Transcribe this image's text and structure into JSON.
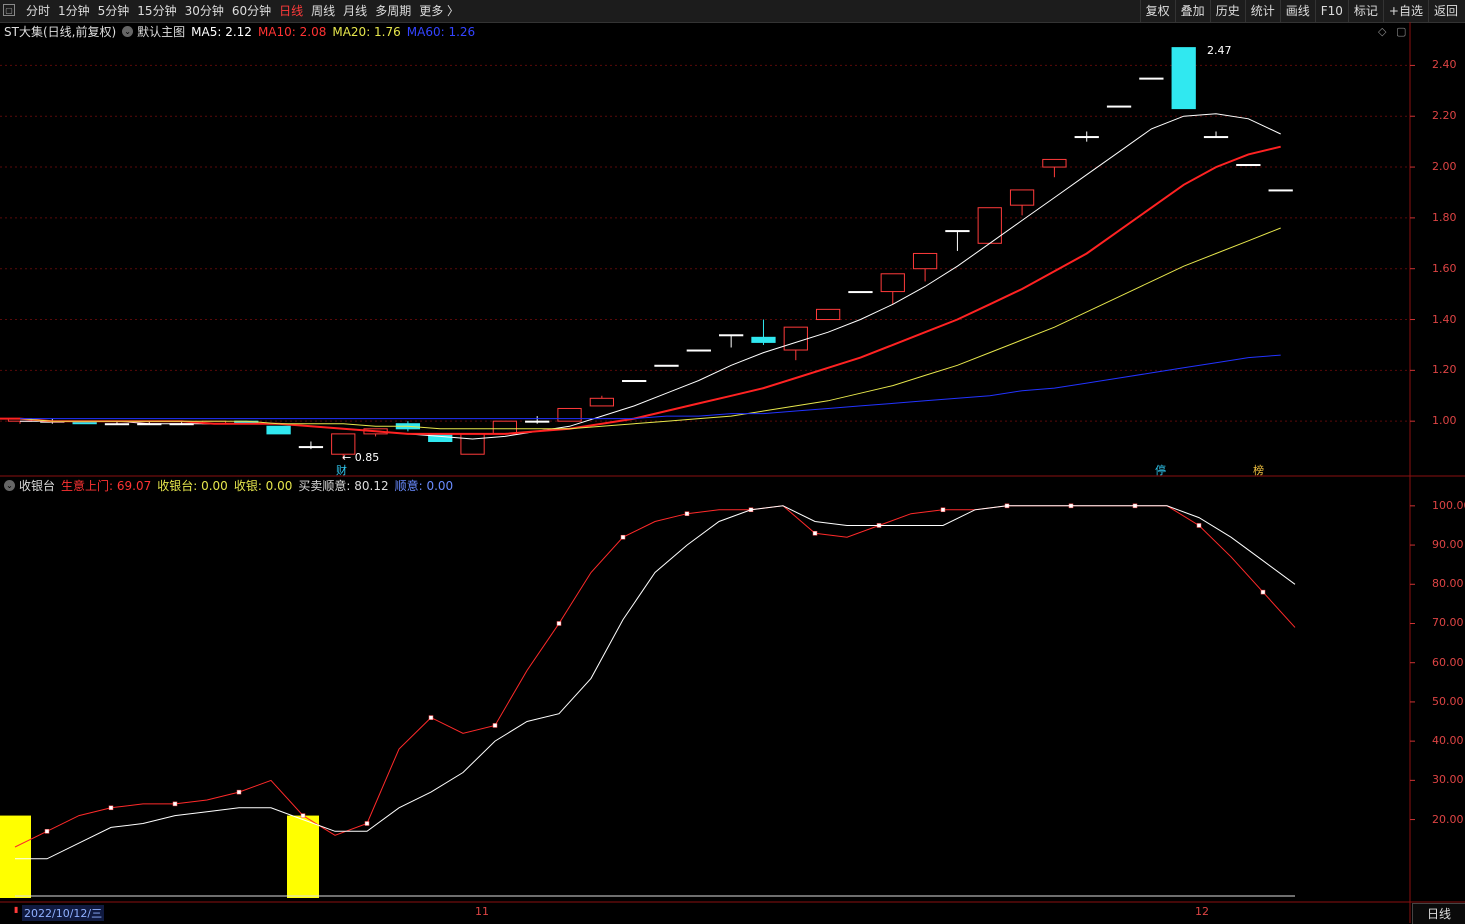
{
  "toolbar": {
    "periods": [
      "分时",
      "1分钟",
      "5分钟",
      "15分钟",
      "30分钟",
      "60分钟",
      "日线",
      "周线",
      "月线",
      "多周期",
      "更多 〉"
    ],
    "active_period": "日线",
    "tools": [
      "复权",
      "叠加",
      "历史",
      "统计",
      "画线",
      "F10",
      "标记",
      "+自选",
      "返回"
    ]
  },
  "main_legend": {
    "stock": "ST大集(日线,前复权)",
    "indicator": "默认主图",
    "ma5": "MA5: 2.12",
    "ma10": "MA10: 2.08",
    "ma20": "MA20: 1.76",
    "ma60": "MA60: 1.26"
  },
  "sub_legend": {
    "name": "收银台",
    "v1": "生意上门: 69.07",
    "v2": "收银台: 0.00",
    "v3": "收银: 0.00",
    "v4": "买卖顺意: 80.12",
    "v5": "顺意: 0.00"
  },
  "annotations": {
    "high": "2.47",
    "low": "0.85",
    "cai": "财",
    "ting": "停",
    "bang": "榜"
  },
  "x_axis": {
    "date": "2022/10/12/三",
    "m11": "11",
    "m12": "12"
  },
  "bottom_tab": "日线",
  "colors": {
    "up": "#ff3b3b",
    "down": "#30e8f0",
    "ma5": "#ffffff",
    "ma10": "#ff2222",
    "ma20": "#e6e64c",
    "ma60": "#2233ff",
    "sub_red": "#ff2a2a",
    "sub_white": "#ffffff",
    "bar": "#ffff00"
  },
  "chart_data": [
    {
      "type": "candlestick",
      "y_ticks": [
        1.0,
        1.2,
        1.4,
        1.6,
        1.8,
        2.0,
        2.2,
        2.4
      ],
      "ylim": [
        0.8,
        2.5
      ],
      "candles": [
        {
          "o": 1.0,
          "c": 1.01,
          "h": 1.01,
          "l": 0.99
        },
        {
          "o": 1.0,
          "c": 1.0,
          "h": 1.01,
          "l": 0.99
        },
        {
          "o": 1.0,
          "c": 0.99,
          "h": 1.0,
          "l": 0.99
        },
        {
          "o": 0.99,
          "c": 0.99,
          "h": 1.0,
          "l": 0.99
        },
        {
          "o": 0.99,
          "c": 0.99,
          "h": 1.0,
          "l": 0.99
        },
        {
          "o": 0.99,
          "c": 0.99,
          "h": 1.0,
          "l": 0.99
        },
        {
          "o": 0.99,
          "c": 1.0,
          "h": 1.0,
          "l": 0.99
        },
        {
          "o": 1.0,
          "c": 0.99,
          "h": 1.0,
          "l": 0.99
        },
        {
          "o": 0.98,
          "c": 0.95,
          "h": 0.98,
          "l": 0.95
        },
        {
          "o": 0.9,
          "c": 0.9,
          "h": 0.92,
          "l": 0.89
        },
        {
          "o": 0.87,
          "c": 0.95,
          "h": 0.95,
          "l": 0.85
        },
        {
          "o": 0.95,
          "c": 0.97,
          "h": 0.97,
          "l": 0.94
        },
        {
          "o": 0.99,
          "c": 0.97,
          "h": 1.0,
          "l": 0.96
        },
        {
          "o": 0.95,
          "c": 0.92,
          "h": 0.95,
          "l": 0.92
        },
        {
          "o": 0.87,
          "c": 0.95,
          "h": 0.95,
          "l": 0.87
        },
        {
          "o": 0.95,
          "c": 1.0,
          "h": 1.0,
          "l": 0.95
        },
        {
          "o": 1.0,
          "c": 1.0,
          "h": 1.02,
          "l": 0.99
        },
        {
          "o": 1.0,
          "c": 1.05,
          "h": 1.05,
          "l": 1.0
        },
        {
          "o": 1.06,
          "c": 1.09,
          "h": 1.1,
          "l": 1.06
        },
        {
          "o": 1.16,
          "c": 1.16,
          "h": 1.16,
          "l": 1.16
        },
        {
          "o": 1.22,
          "c": 1.22,
          "h": 1.22,
          "l": 1.22
        },
        {
          "o": 1.28,
          "c": 1.28,
          "h": 1.28,
          "l": 1.28
        },
        {
          "o": 1.34,
          "c": 1.34,
          "h": 1.34,
          "l": 1.29
        },
        {
          "o": 1.33,
          "c": 1.31,
          "h": 1.4,
          "l": 1.3
        },
        {
          "o": 1.28,
          "c": 1.37,
          "h": 1.37,
          "l": 1.24
        },
        {
          "o": 1.4,
          "c": 1.44,
          "h": 1.44,
          "l": 1.4
        },
        {
          "o": 1.51,
          "c": 1.51,
          "h": 1.51,
          "l": 1.51
        },
        {
          "o": 1.51,
          "c": 1.58,
          "h": 1.58,
          "l": 1.46
        },
        {
          "o": 1.6,
          "c": 1.66,
          "h": 1.66,
          "l": 1.55
        },
        {
          "o": 1.75,
          "c": 1.75,
          "h": 1.75,
          "l": 1.67
        },
        {
          "o": 1.7,
          "c": 1.84,
          "h": 1.84,
          "l": 1.7
        },
        {
          "o": 1.85,
          "c": 1.91,
          "h": 1.91,
          "l": 1.81
        },
        {
          "o": 2.0,
          "c": 2.03,
          "h": 2.03,
          "l": 1.96
        },
        {
          "o": 2.12,
          "c": 2.12,
          "h": 2.14,
          "l": 2.1
        },
        {
          "o": 2.24,
          "c": 2.24,
          "h": 2.24,
          "l": 2.24
        },
        {
          "o": 2.35,
          "c": 2.35,
          "h": 2.35,
          "l": 2.35
        },
        {
          "o": 2.47,
          "c": 2.23,
          "h": 2.47,
          "l": 2.23
        },
        {
          "o": 2.12,
          "c": 2.12,
          "h": 2.14,
          "l": 2.12
        },
        {
          "o": 2.01,
          "c": 2.01,
          "h": 2.01,
          "l": 2.01
        },
        {
          "o": 1.91,
          "c": 1.91,
          "h": 1.91,
          "l": 1.91
        }
      ],
      "series": [
        {
          "name": "MA5",
          "color": "#ffffff",
          "values": [
            1.0,
            1.0,
            1.0,
            1.0,
            0.99,
            0.99,
            0.99,
            0.99,
            0.99,
            0.98,
            0.97,
            0.96,
            0.95,
            0.94,
            0.93,
            0.94,
            0.96,
            0.98,
            1.02,
            1.06,
            1.11,
            1.16,
            1.22,
            1.27,
            1.31,
            1.35,
            1.4,
            1.46,
            1.53,
            1.61,
            1.7,
            1.79,
            1.88,
            1.97,
            2.06,
            2.15,
            2.2,
            2.21,
            2.19,
            2.13
          ]
        },
        {
          "name": "MA10",
          "color": "#ff2222",
          "values": [
            1.01,
            1.01,
            1.0,
            1.0,
            1.0,
            1.0,
            1.0,
            0.99,
            0.99,
            0.99,
            0.98,
            0.97,
            0.96,
            0.95,
            0.95,
            0.95,
            0.95,
            0.96,
            0.97,
            0.99,
            1.01,
            1.04,
            1.07,
            1.1,
            1.13,
            1.17,
            1.21,
            1.25,
            1.3,
            1.35,
            1.4,
            1.46,
            1.52,
            1.59,
            1.66,
            1.75,
            1.84,
            1.93,
            2.0,
            2.05,
            2.08
          ]
        },
        {
          "name": "MA20",
          "color": "#e6e64c",
          "values": [
            1.01,
            1.0,
            1.0,
            1.0,
            1.0,
            1.0,
            1.0,
            1.0,
            0.99,
            0.99,
            0.99,
            0.98,
            0.98,
            0.97,
            0.97,
            0.97,
            0.97,
            0.97,
            0.98,
            0.99,
            1.0,
            1.01,
            1.02,
            1.04,
            1.06,
            1.08,
            1.11,
            1.14,
            1.18,
            1.22,
            1.27,
            1.32,
            1.37,
            1.43,
            1.49,
            1.55,
            1.61,
            1.66,
            1.71,
            1.76
          ]
        },
        {
          "name": "MA60",
          "color": "#2233ff",
          "values": [
            1.01,
            1.01,
            1.01,
            1.01,
            1.01,
            1.01,
            1.01,
            1.01,
            1.01,
            1.01,
            1.01,
            1.01,
            1.01,
            1.01,
            1.01,
            1.01,
            1.01,
            1.01,
            1.01,
            1.01,
            1.02,
            1.02,
            1.03,
            1.03,
            1.04,
            1.05,
            1.06,
            1.07,
            1.08,
            1.09,
            1.1,
            1.12,
            1.13,
            1.15,
            1.17,
            1.19,
            1.21,
            1.23,
            1.25,
            1.26
          ]
        }
      ]
    },
    {
      "type": "line",
      "y_ticks": [
        20,
        30,
        40,
        50,
        60,
        70,
        80,
        90,
        100
      ],
      "ylim": [
        0,
        102
      ],
      "series": [
        {
          "name": "生意上门",
          "color": "#ff2a2a",
          "values": [
            13,
            17,
            21,
            23,
            24,
            24,
            25,
            27,
            30,
            21,
            16,
            19,
            38,
            46,
            42,
            44,
            58,
            70,
            83,
            92,
            96,
            98,
            99,
            99,
            100,
            93,
            92,
            95,
            98,
            99,
            99,
            100,
            100,
            100,
            100,
            100,
            100,
            95,
            87,
            78,
            69
          ]
        },
        {
          "name": "买卖顺意",
          "color": "#ffffff",
          "values": [
            10,
            10,
            14,
            18,
            19,
            21,
            22,
            23,
            23,
            20,
            17,
            17,
            23,
            27,
            32,
            40,
            45,
            47,
            56,
            71,
            83,
            90,
            96,
            99,
            100,
            96,
            95,
            95,
            95,
            95,
            99,
            100,
            100,
            100,
            100,
            100,
            100,
            97,
            92,
            86,
            80
          ]
        }
      ],
      "bars": [
        {
          "index": 0,
          "value": 20,
          "color": "#ffff00"
        },
        {
          "index": 9,
          "value": 20,
          "color": "#ffff00"
        }
      ]
    }
  ]
}
